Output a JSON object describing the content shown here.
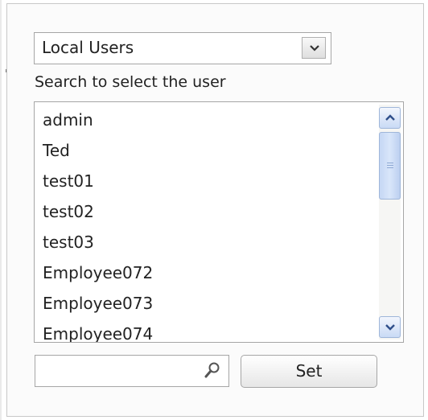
{
  "user_source_select": {
    "selected": "Local Users"
  },
  "search_label": "Search to select the user",
  "users": [
    "admin",
    "Ted",
    "test01",
    "test02",
    "test03",
    "Employee072",
    "Employee073",
    "Employee074"
  ],
  "search_field": {
    "value": "",
    "placeholder": ""
  },
  "set_button_label": "Set",
  "icons": {
    "dropdown": "chevron-down-icon",
    "scroll_up": "chevron-up-icon",
    "scroll_down": "chevron-down-icon",
    "search": "magnifier-icon"
  },
  "colors": {
    "scrollbar_accent": "#c9daf5",
    "panel_background": "#fbfbfb"
  }
}
